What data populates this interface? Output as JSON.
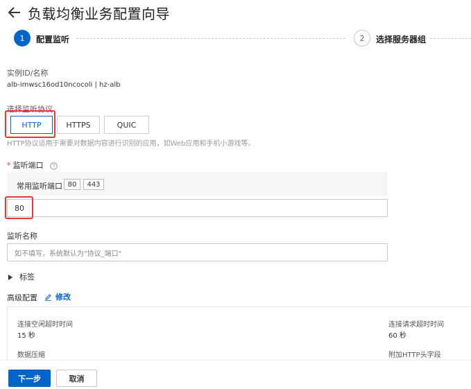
{
  "header": {
    "title": "负载均衡业务配置向导",
    "back_icon": "arrow-left-icon"
  },
  "steps": [
    {
      "number": "1",
      "label": "配置监听",
      "active": true
    },
    {
      "number": "2",
      "label": "选择服务器组",
      "active": false
    }
  ],
  "instance": {
    "label": "实例ID/名称",
    "value": "alb-imwsc16od10ncocoli | hz-alb"
  },
  "protocol": {
    "label": "选择监听协议",
    "options": [
      "HTTP",
      "HTTPS",
      "QUIC"
    ],
    "selected": "HTTP",
    "hint": "HTTP协议适用于需要对数据内容进行识别的应用，如Web应用和手机小游戏等。"
  },
  "port": {
    "required": "*",
    "label": "监听端口",
    "common_label": "常用监听端口：",
    "common_ports": [
      "80",
      "443"
    ],
    "value": "80"
  },
  "listener_name": {
    "label": "监听名称",
    "placeholder": "如不填写，系统默认为\"协议_端口\""
  },
  "tags": {
    "label": "标签"
  },
  "advanced": {
    "label": "高级配置",
    "edit_label": "修改",
    "idle_timeout_label": "连接空闲超时时间",
    "idle_timeout_value": "15 秒",
    "request_timeout_label": "连接请求超时时间",
    "request_timeout_value": "60 秒",
    "compression_label": "数据压缩",
    "http_header_label": "附加HTTP头字段"
  },
  "footer": {
    "next_label": "下一步",
    "cancel_label": "取消"
  },
  "colors": {
    "primary": "#0064c8",
    "highlight": "#e53935"
  }
}
